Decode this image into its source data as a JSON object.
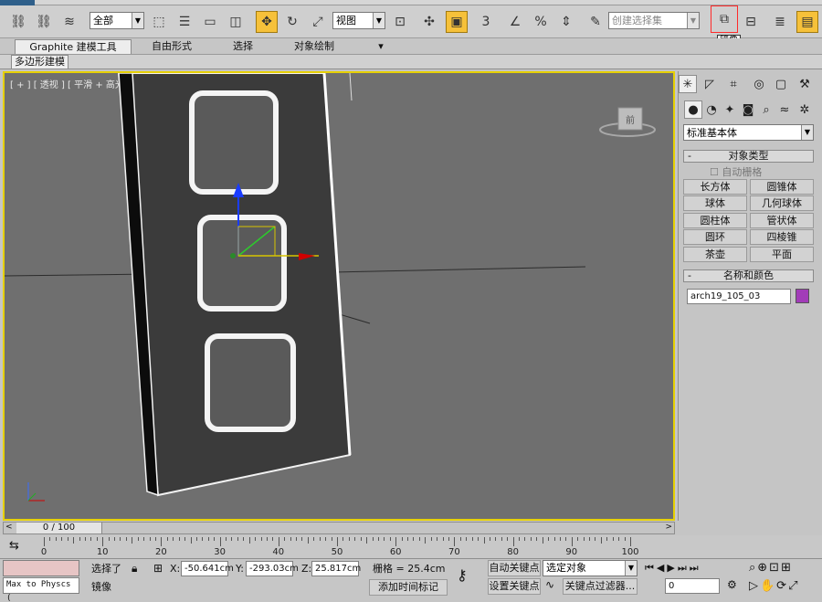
{
  "toolbar": {
    "selection_filter": "全部",
    "ref_coord": "视图",
    "named_selection_placeholder": "创建选择集",
    "snap_label": "3",
    "mirror_tooltip": "镜像"
  },
  "ribbon": {
    "tabs": [
      "Graphite 建模工具",
      "自由形式",
      "选择",
      "对象绘制"
    ],
    "subtab": "多边形建模"
  },
  "viewport": {
    "label": "[ + ] [ 透视 ] [ 平滑 + 高光 + 边面 ]",
    "viewcube_face": "前"
  },
  "command_panel": {
    "category": "标准基本体",
    "rollout_object_type": "对象类型",
    "autogrid": "自动栅格",
    "buttons": [
      "长方体",
      "圆锥体",
      "球体",
      "几何球体",
      "圆柱体",
      "管状体",
      "圆环",
      "四棱锥",
      "茶壶",
      "平面"
    ],
    "rollout_name_color": "名称和颜色",
    "object_name": "arch19_105_03",
    "object_color": "#a23cb8"
  },
  "timeline": {
    "position": "0 / 100",
    "ticks": [
      "0",
      "10",
      "20",
      "30",
      "40",
      "50",
      "60",
      "70",
      "80",
      "90",
      "100"
    ]
  },
  "status": {
    "script_listener": "Max to Physcs (",
    "selected": "选择了",
    "x_label": "X:",
    "x_value": "-50.641cm",
    "y_label": "Y:",
    "y_value": "-293.03cm",
    "z_label": "Z:",
    "z_value": "25.817cm",
    "grid": "栅格 = 25.4cm",
    "autokey": "自动关键点",
    "setkey": "设置关键点",
    "key_mode": "选定对象",
    "key_filters": "关键点过滤器...",
    "prompt": "镜像",
    "add_time_tag": "添加时间标记",
    "frame": "0"
  }
}
